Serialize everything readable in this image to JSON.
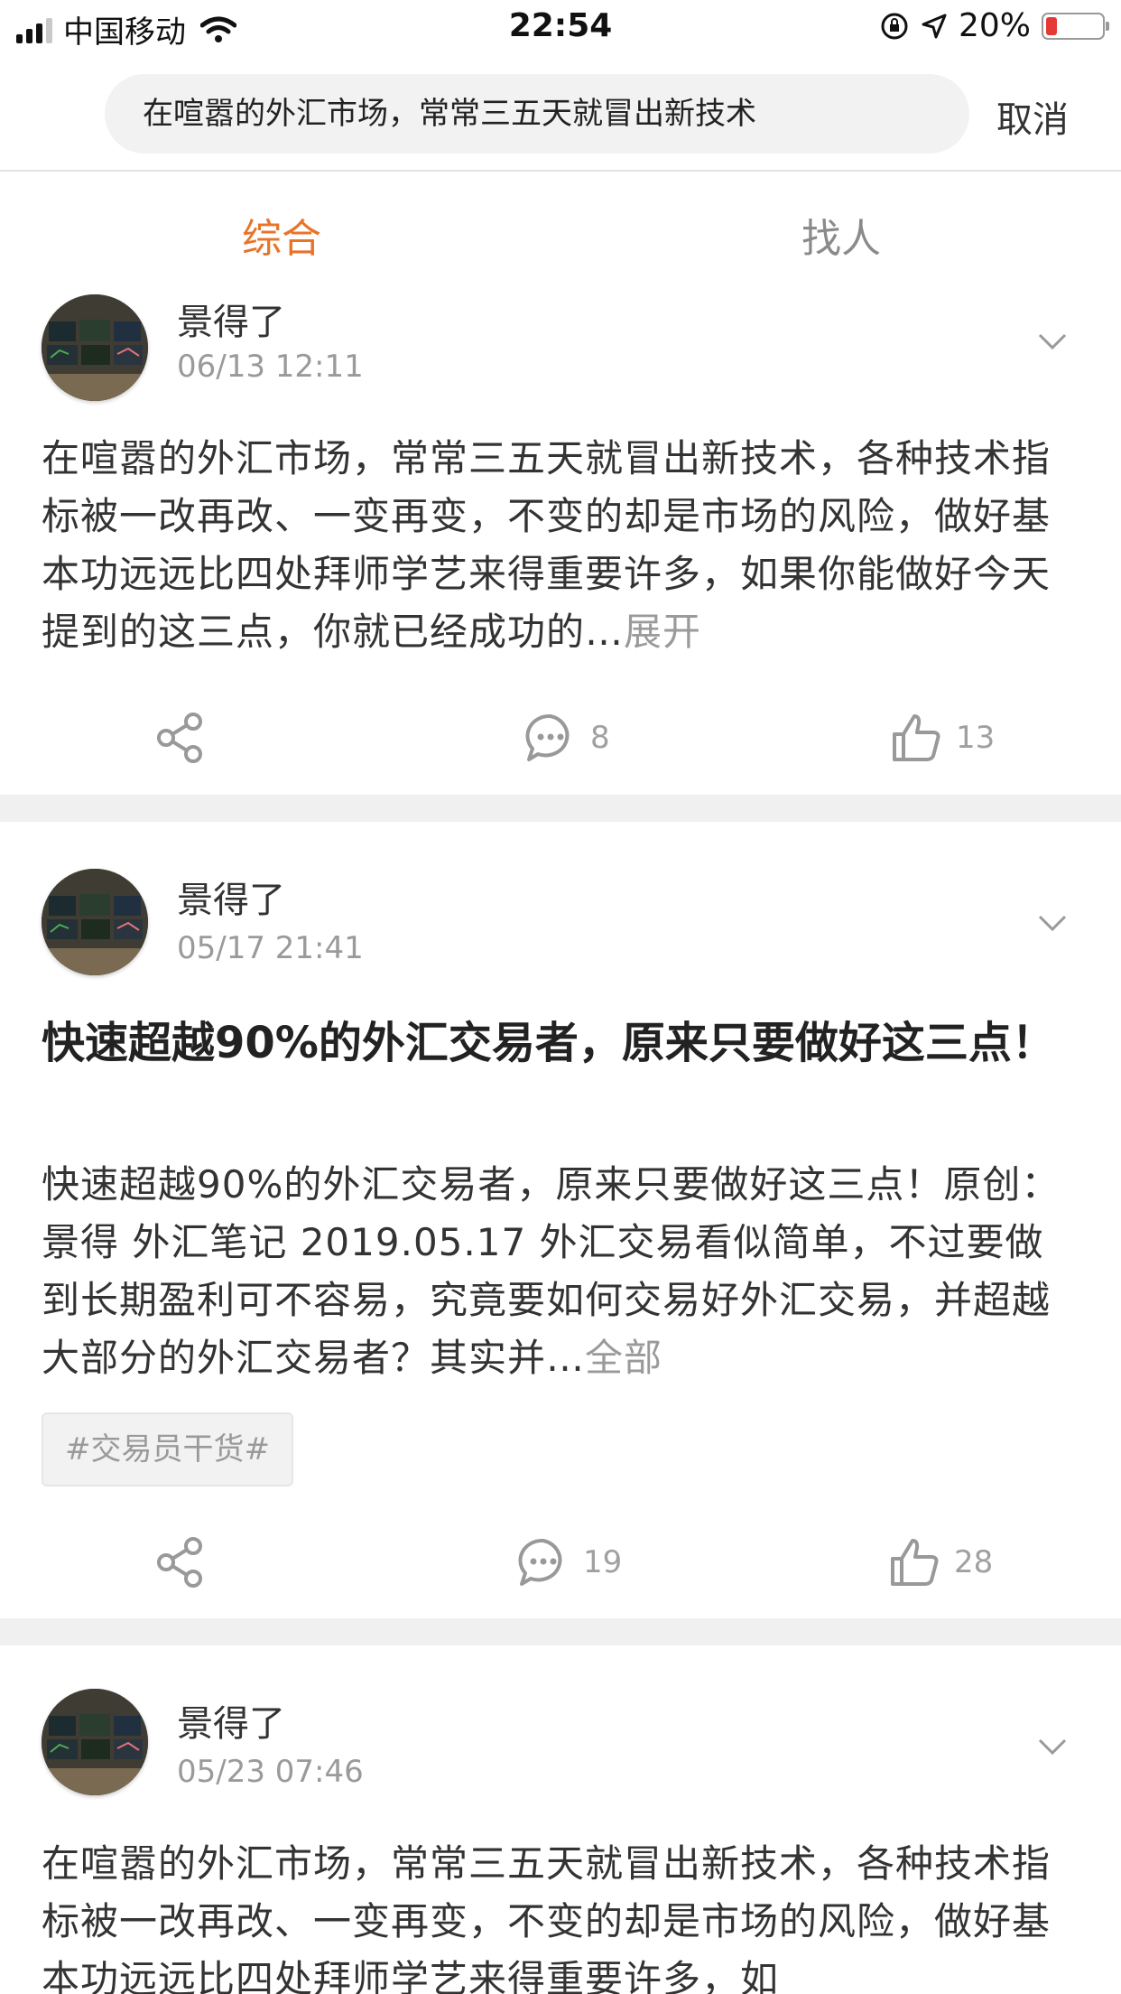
{
  "status_bar": {
    "carrier": "中国移动",
    "time": "22:54",
    "battery": "20%"
  },
  "search": {
    "query": "在喧嚣的外汇市场，常常三五天就冒出新技术",
    "cancel_label": "取消"
  },
  "tabs": [
    {
      "label": "综合",
      "active": true
    },
    {
      "label": "找人",
      "active": false
    }
  ],
  "posts": [
    {
      "author": "景得了",
      "date": "06/13 12:11",
      "text": "在喧嚣的外汇市场，常常三五天就冒出新技术，各种技术指标被一改再改、一变再变，不变的却是市场的风险，做好基本功远远比四处拜师学艺来得重要许多，如果你能做好今天提到的这三点，你就已经成功的…",
      "more_label": "展开",
      "comments": "8",
      "likes": "13"
    },
    {
      "author": "景得了",
      "date": "05/17 21:41",
      "title": "快速超越90%的外汇交易者，原来只要做好这三点！",
      "text": "快速超越90%的外汇交易者，原来只要做好这三点！原创： 景得 外汇笔记 2019.05.17 外汇交易看似简单，不过要做到长期盈利可不容易，究竟要如何交易好外汇交易，并超越大部分的外汇交易者？其实并…",
      "more_label": "全部",
      "tag": "#交易员干货#",
      "comments": "19",
      "likes": "28"
    },
    {
      "author": "景得了",
      "date": "05/23 07:46",
      "text": "在喧嚣的外汇市场，常常三五天就冒出新技术，各种技术指标被一改再改、一变再变，不变的却是市场的风险，做好基本功远远比四处拜师学艺来得重要许多，如"
    }
  ],
  "colors": {
    "accent": "#e8742a",
    "muted": "#9a9a9a",
    "divider": "#f0f0f0"
  }
}
